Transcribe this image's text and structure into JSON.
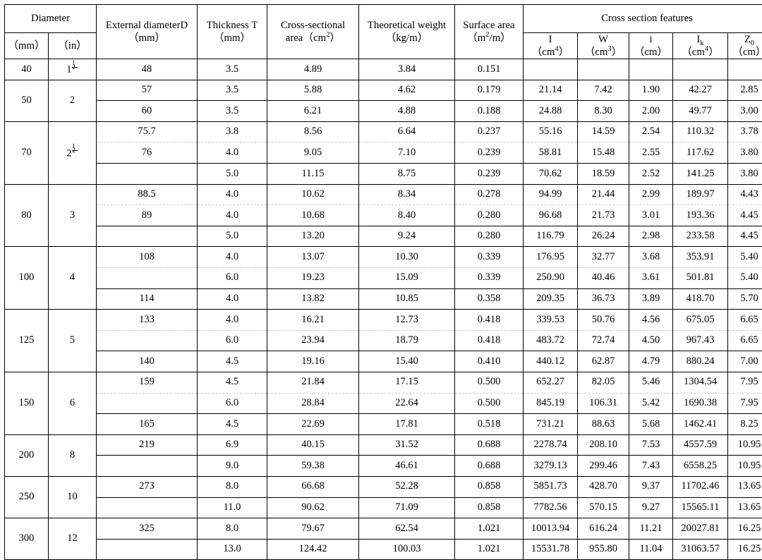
{
  "table": {
    "header": {
      "diameter_group": "Diameter",
      "diameter_mm": "（mm）",
      "diameter_in": "（in）",
      "external_d": "External diameterD",
      "external_d_unit": "（mm）",
      "thickness": "Thickness T",
      "thickness_unit": "（mm）",
      "area": "Cross-sectional",
      "area_line2": "area（cm",
      "area_line2_sup": "2",
      "area_line2_end": "）",
      "weight": "Theoretical weight",
      "weight_unit": "（kg/m）",
      "surface": "Surface area",
      "surface_unit_pre": "（m",
      "surface_unit_sup": "2",
      "surface_unit_post": "/m）",
      "cross_section_features": "Cross section features",
      "I": "I",
      "I_unit_pre": "（cm",
      "I_unit_sup": "4",
      "I_unit_post": "）",
      "W": "W",
      "W_unit_pre": "（cm",
      "W_unit_sup": "3",
      "W_unit_post": "）",
      "i": "i",
      "i_unit": "（cm）",
      "Ik": "I",
      "Ik_sub": "k",
      "Ik_unit_pre": "（cm",
      "Ik_unit_sup": "4",
      "Ik_unit_post": "）",
      "Z0": "Z",
      "Z0_sub": "0",
      "Z0_unit": "（cm）"
    },
    "groups": [
      {
        "dn_mm": "40",
        "dn_in_whole": "1",
        "dn_in_num": "1",
        "dn_in_den": "2",
        "rows": [
          {
            "D": "48",
            "T": "3.5",
            "A": "4.89",
            "G": "3.84",
            "S": "0.151",
            "I": "",
            "W": "",
            "i": "",
            "Ik": "",
            "Z0": ""
          }
        ]
      },
      {
        "dn_mm": "50",
        "dn_in_whole": "2",
        "rows": [
          {
            "D": "57",
            "T": "3.5",
            "A": "5.88",
            "G": "4.62",
            "S": "0.179",
            "I": "21.14",
            "W": "7.42",
            "i": "1.90",
            "Ik": "42.27",
            "Z0": "2.85"
          },
          {
            "D": "60",
            "T": "3.5",
            "A": "6.21",
            "G": "4.88",
            "S": "0.188",
            "I": "24.88",
            "W": "8.30",
            "i": "2.00",
            "Ik": "49.77",
            "Z0": "3.00"
          }
        ]
      },
      {
        "dn_mm": "70",
        "dn_in_whole": "2",
        "dn_in_num": "1",
        "dn_in_den": "2",
        "rows": [
          {
            "D": "75.7",
            "T": "3.8",
            "A": "8.56",
            "G": "6.64",
            "S": "0.237",
            "I": "55.16",
            "W": "14.59",
            "i": "2.54",
            "Ik": "110.32",
            "Z0": "3.78"
          },
          {
            "D": "76",
            "T": "4.0",
            "A": "9.05",
            "G": "7.10",
            "S": "0.239",
            "I": "58.81",
            "W": "15.48",
            "i": "2.55",
            "Ik": "117.62",
            "Z0": "3.80"
          },
          {
            "D": "",
            "T": "5.0",
            "A": "11.15",
            "G": "8.75",
            "S": "0.239",
            "I": "70.62",
            "W": "18.59",
            "i": "2.52",
            "Ik": "141.25",
            "Z0": "3.80"
          }
        ]
      },
      {
        "dn_mm": "80",
        "dn_in_whole": "3",
        "rows": [
          {
            "D": "88.5",
            "T": "4.0",
            "A": "10.62",
            "G": "8.34",
            "S": "0.278",
            "I": "94.99",
            "W": "21.44",
            "i": "2.99",
            "Ik": "189.97",
            "Z0": "4.43"
          },
          {
            "D": "89",
            "T": "4.0",
            "A": "10.68",
            "G": "8.40",
            "S": "0.280",
            "I": "96.68",
            "W": "21.73",
            "i": "3.01",
            "Ik": "193.36",
            "Z0": "4.45"
          },
          {
            "D": "",
            "T": "5.0",
            "A": "13.20",
            "G": "9.24",
            "S": "0.280",
            "I": "116.79",
            "W": "26.24",
            "i": "2.98",
            "Ik": "233.58",
            "Z0": "4.45"
          }
        ]
      },
      {
        "dn_mm": "100",
        "dn_in_whole": "4",
        "rows": [
          {
            "D": "108",
            "T": "4.0",
            "A": "13.07",
            "G": "10.30",
            "S": "0.339",
            "I": "176.95",
            "W": "32.77",
            "i": "3.68",
            "Ik": "353.91",
            "Z0": "5.40"
          },
          {
            "D": "",
            "T": "6.0",
            "A": "19.23",
            "G": "15.09",
            "S": "0.339",
            "I": "250.90",
            "W": "40.46",
            "i": "3.61",
            "Ik": "501.81",
            "Z0": "5.40"
          },
          {
            "D": "114",
            "T": "4.0",
            "A": "13.82",
            "G": "10.85",
            "S": "0.358",
            "I": "209.35",
            "W": "36.73",
            "i": "3.89",
            "Ik": "418.70",
            "Z0": "5.70"
          }
        ]
      },
      {
        "dn_mm": "125",
        "dn_in_whole": "5",
        "rows": [
          {
            "D": "133",
            "T": "4.0",
            "A": "16.21",
            "G": "12.73",
            "S": "0.418",
            "I": "339.53",
            "W": "50.76",
            "i": "4.56",
            "Ik": "675.05",
            "Z0": "6.65"
          },
          {
            "D": "",
            "T": "6.0",
            "A": "23.94",
            "G": "18.79",
            "S": "0.418",
            "I": "483.72",
            "W": "72.74",
            "i": "4.50",
            "Ik": "967.43",
            "Z0": "6.65"
          },
          {
            "D": "140",
            "T": "4.5",
            "A": "19.16",
            "G": "15.40",
            "S": "0.410",
            "I": "440.12",
            "W": "62.87",
            "i": "4.79",
            "Ik": "880.24",
            "Z0": "7.00"
          }
        ]
      },
      {
        "dn_mm": "150",
        "dn_in_whole": "6",
        "rows": [
          {
            "D": "159",
            "T": "4.5",
            "A": "21.84",
            "G": "17.15",
            "S": "0.500",
            "I": "652.27",
            "W": "82.05",
            "i": "5.46",
            "Ik": "1304.54",
            "Z0": "7.95"
          },
          {
            "D": "",
            "T": "6.0",
            "A": "28.84",
            "G": "22.64",
            "S": "0.500",
            "I": "845.19",
            "W": "106.31",
            "i": "5.42",
            "Ik": "1690.38",
            "Z0": "7.95"
          },
          {
            "D": "165",
            "T": "4.5",
            "A": "22.69",
            "G": "17.81",
            "S": "0.518",
            "I": "731.21",
            "W": "88.63",
            "i": "5.68",
            "Ik": "1462.41",
            "Z0": "8.25"
          }
        ]
      },
      {
        "dn_mm": "200",
        "dn_in_whole": "8",
        "rows": [
          {
            "D": "219",
            "T": "6.9",
            "A": "40.15",
            "G": "31.52",
            "S": "0.688",
            "I": "2278.74",
            "W": "208.10",
            "i": "7.53",
            "Ik": "4557.59",
            "Z0": "10.95"
          },
          {
            "D": "",
            "T": "9.0",
            "A": "59.38",
            "G": "46.61",
            "S": "0.688",
            "I": "3279.13",
            "W": "299.46",
            "i": "7.43",
            "Ik": "6558.25",
            "Z0": "10.95"
          }
        ]
      },
      {
        "dn_mm": "250",
        "dn_in_whole": "10",
        "rows": [
          {
            "D": "273",
            "T": "8.0",
            "A": "66.68",
            "G": "52.28",
            "S": "0.858",
            "I": "5851.73",
            "W": "428.70",
            "i": "9.37",
            "Ik": "11702.46",
            "Z0": "13.65"
          },
          {
            "D": "",
            "T": "11.0",
            "A": "90.62",
            "G": "71.09",
            "S": "0.858",
            "I": "7782.56",
            "W": "570.15",
            "i": "9.27",
            "Ik": "15565.11",
            "Z0": "13.65"
          }
        ]
      },
      {
        "dn_mm": "300",
        "dn_in_whole": "12",
        "rows": [
          {
            "D": "325",
            "T": "8.0",
            "A": "79.67",
            "G": "62.54",
            "S": "1.021",
            "I": "10013.94",
            "W": "616.24",
            "i": "11.21",
            "Ik": "20027.81",
            "Z0": "16.25"
          },
          {
            "D": "",
            "T": "13.0",
            "A": "124.42",
            "G": "100.03",
            "S": "1.021",
            "I": "15531.78",
            "W": "955.80",
            "i": "11.04",
            "Ik": "31063.57",
            "Z0": "16.25"
          }
        ]
      }
    ]
  }
}
